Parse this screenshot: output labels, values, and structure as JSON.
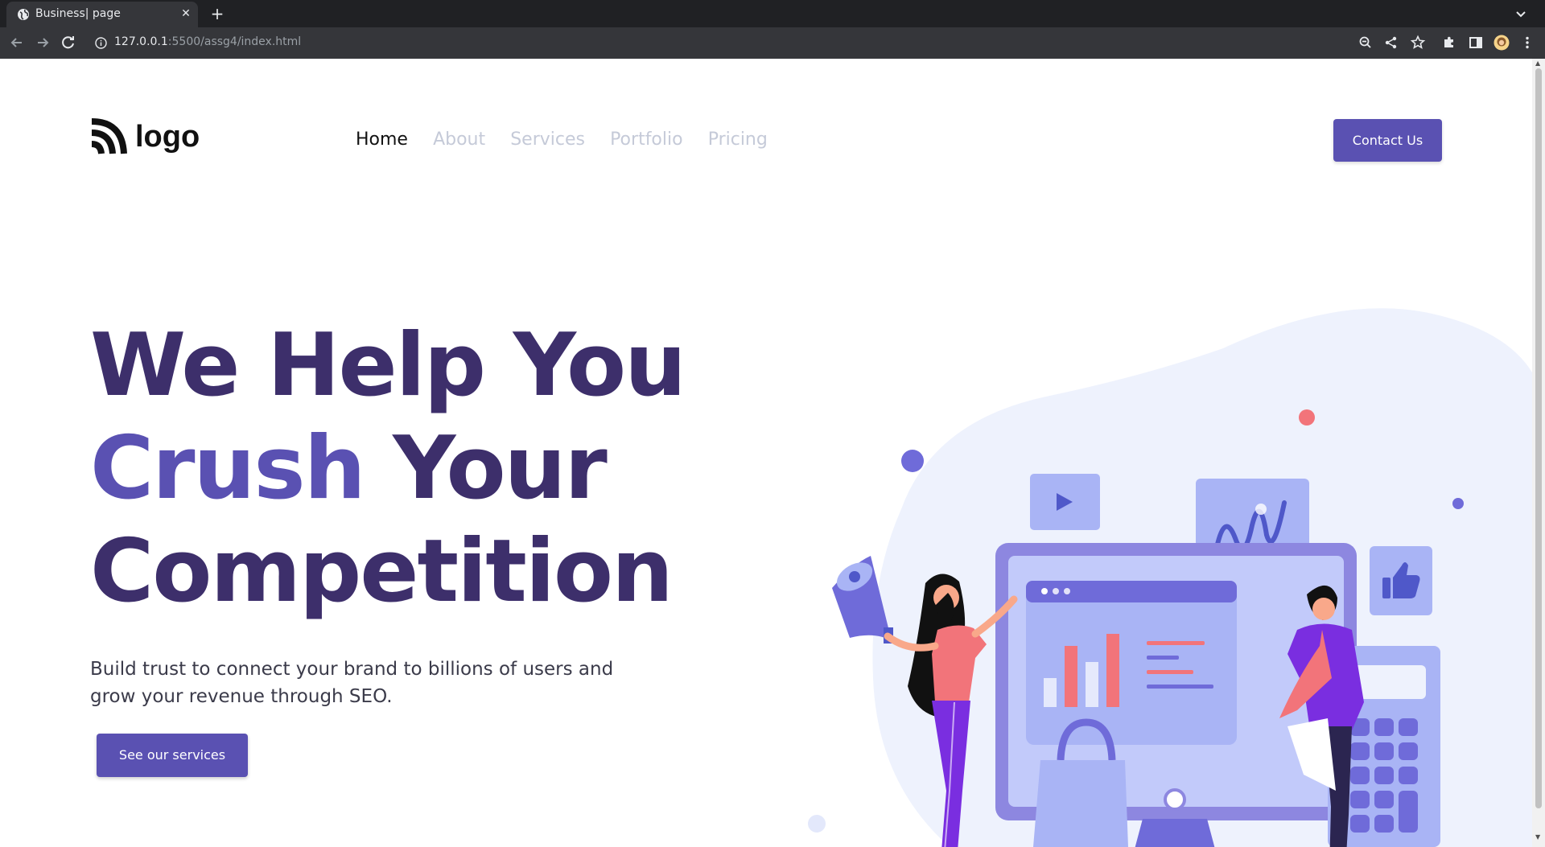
{
  "browser": {
    "tab_title": "Business| page",
    "url_host": "127.0.0.1",
    "url_rest": ":5500/assg4/index.html"
  },
  "site": {
    "logo_text": "logo",
    "nav": {
      "home": "Home",
      "about": "About",
      "services": "Services",
      "portfolio": "Portfolio",
      "pricing": "Pricing"
    },
    "contact_label": "Contact Us"
  },
  "hero": {
    "headline_line1": "We Help You",
    "headline_accent": "Crush",
    "headline_line2_rest": " Your",
    "headline_line3": "Competition",
    "subtext": "Build trust to connect your brand to billions of users and grow your revenue through SEO.",
    "cta_label": "See our services"
  },
  "colors": {
    "brand": "#5a51b2",
    "headline": "#3d2f6b",
    "nav_inactive": "#c5cad8",
    "illustration_light": "#eef2fd",
    "illustration_mid": "#a9b4f5",
    "illustration_dark": "#6f6bd9",
    "coral": "#f2747a"
  },
  "icons": [
    "globe-icon",
    "close-icon",
    "plus-icon",
    "chevron-down-icon",
    "back-arrow-icon",
    "forward-arrow-icon",
    "reload-icon",
    "info-icon",
    "zoom-icon",
    "share-icon",
    "star-icon",
    "puzzle-icon",
    "sidebar-icon",
    "profile-avatar-icon",
    "more-vert-icon",
    "logo-mark-icon"
  ]
}
